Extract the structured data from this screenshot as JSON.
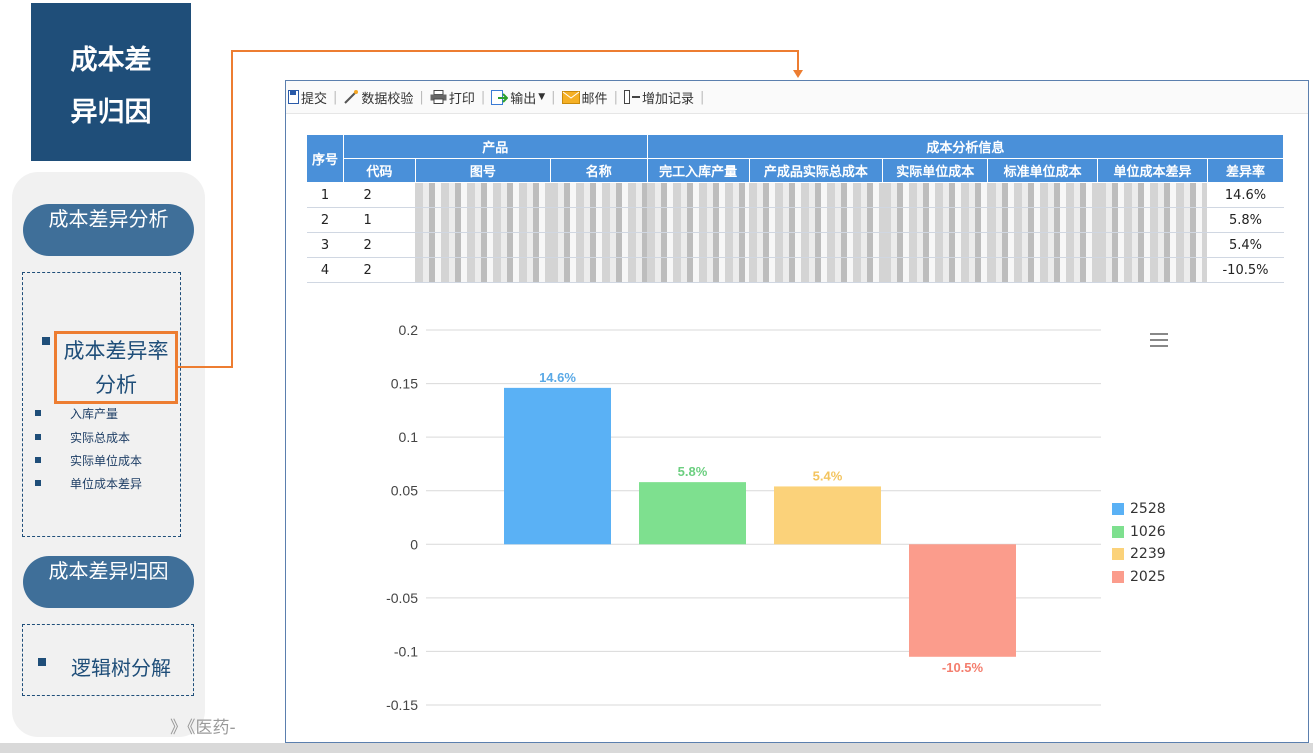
{
  "title": {
    "line1": "成本差",
    "line2": "异归因"
  },
  "side": {
    "pill1": "成本差异分析",
    "highlight": "成本差异率分析",
    "sub_items": [
      "入库产量",
      "实际总成本",
      "实际单位成本",
      "单位成本差异"
    ],
    "pill2": "成本差异归因",
    "logic_tree": "逻辑树分解"
  },
  "background_text": "》《医药-",
  "toolbar": {
    "submit": "提交",
    "validate": "数据校验",
    "print": "打印",
    "export": "输出",
    "mail": "邮件",
    "add_record": "增加记录"
  },
  "table": {
    "group_headers": {
      "seq": "序号",
      "product": "产品",
      "cost_info": "成本分析信息"
    },
    "headers": [
      "代码",
      "图号",
      "名称",
      "完工入库产量",
      "产成品实际总成本",
      "实际单位成本",
      "标准单位成本",
      "单位成本差异",
      "差异率"
    ],
    "rows": [
      {
        "seq": "1",
        "code": "2",
        "rate": "14.6%"
      },
      {
        "seq": "2",
        "code": "1",
        "rate": "5.8%"
      },
      {
        "seq": "3",
        "code": "2",
        "rate": "5.4%"
      },
      {
        "seq": "4",
        "code": "2",
        "rate": "-10.5%"
      }
    ]
  },
  "chart_data": {
    "type": "bar",
    "categories": [
      "2528",
      "1026",
      "2239",
      "2025"
    ],
    "values": [
      0.146,
      0.058,
      0.054,
      -0.105
    ],
    "data_labels": [
      "14.6%",
      "5.8%",
      "5.4%",
      "-10.5%"
    ],
    "colors": [
      "#5ab1f5",
      "#7ee08f",
      "#fbd27a",
      "#fb9c8c"
    ],
    "label_colors": [
      "#5aa9e6",
      "#6ccf80",
      "#f3c45f",
      "#f47d6d"
    ],
    "ylim": [
      -0.15,
      0.2
    ],
    "yticks": [
      "0.2",
      "0.15",
      "0.1",
      "0.05",
      "0",
      "-0.05",
      "-0.1",
      "-0.15"
    ],
    "grid": true,
    "legend": "right"
  },
  "colors": {
    "accent": "#ed7d31",
    "navy": "#1f4e79",
    "table_header": "#4a90d9"
  }
}
